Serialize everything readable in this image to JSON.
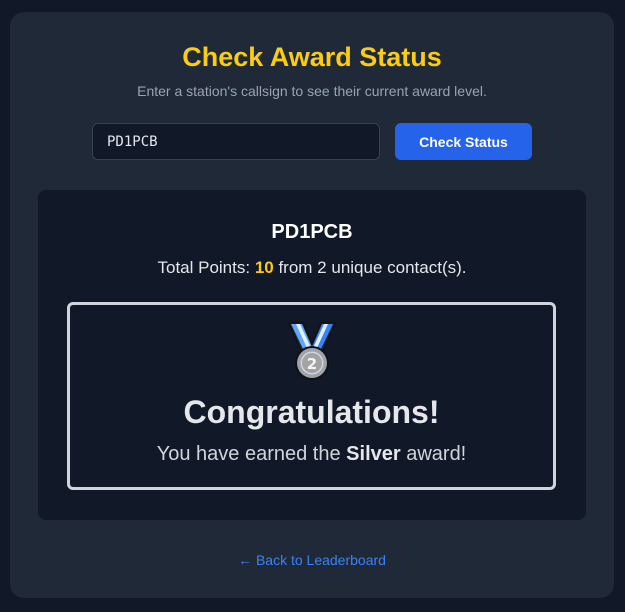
{
  "page": {
    "title": "Check Award Status",
    "subtitle": "Enter a station's callsign to see their current award level."
  },
  "search": {
    "value": "PD1PCB",
    "button_label": "Check Status"
  },
  "result": {
    "callsign": "PD1PCB",
    "points_prefix": "Total Points: ",
    "points": "10",
    "points_suffix": " from 2 unique contact(s).",
    "medal_icon": "second-place-medal-icon",
    "medal_number": "2",
    "congrats": "Congratulations!",
    "earned_prefix": "You have earned the ",
    "award_level": "Silver",
    "earned_suffix": " award!"
  },
  "footer": {
    "back_link": "← Back to Leaderboard"
  },
  "colors": {
    "accent_yellow": "#facc15",
    "button_blue": "#2563eb",
    "link_blue": "#3b82f6",
    "card_bg": "#1f2937",
    "page_bg": "#111827"
  }
}
